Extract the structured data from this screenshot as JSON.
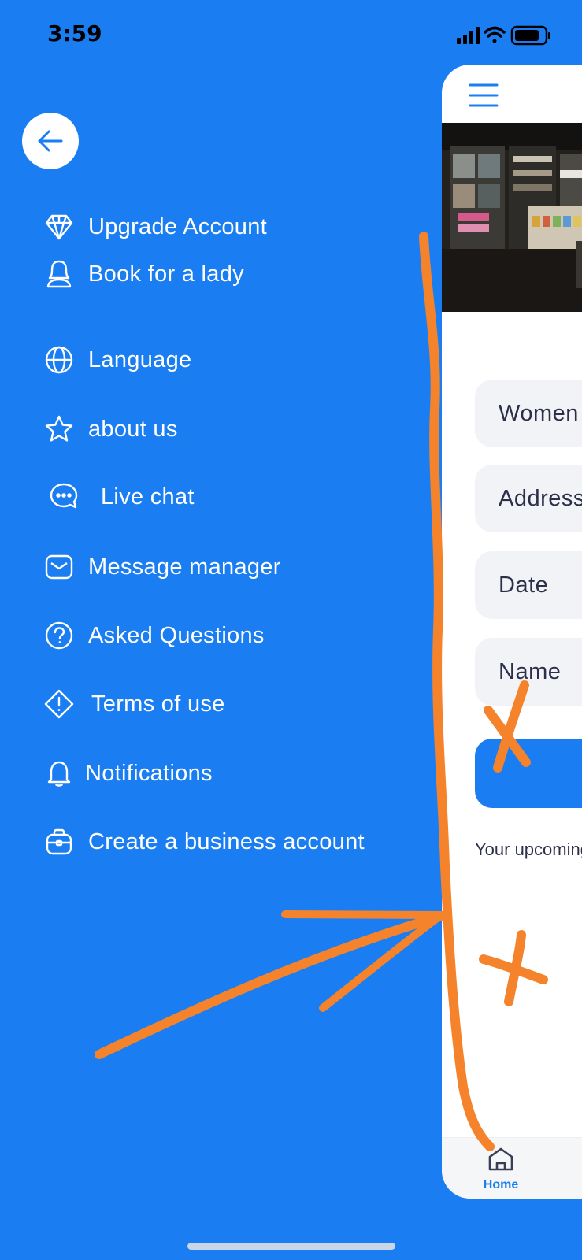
{
  "status_bar": {
    "time": "3:59"
  },
  "menu": {
    "items": [
      {
        "label": "Upgrade Account",
        "icon": "diamond-icon"
      },
      {
        "label": "Book for a lady",
        "icon": "woman-icon"
      },
      {
        "label": "Language",
        "icon": "globe-icon"
      },
      {
        "label": "about us",
        "icon": "star-icon"
      },
      {
        "label": "Live chat",
        "icon": "chat-icon"
      },
      {
        "label": "Message manager",
        "icon": "envelope-icon"
      },
      {
        "label": "Asked Questions",
        "icon": "question-icon"
      },
      {
        "label": "Terms of use",
        "icon": "warning-diamond-icon"
      },
      {
        "label": "Notifications",
        "icon": "bell-icon"
      },
      {
        "label": "Create a business account",
        "icon": "briefcase-icon"
      }
    ]
  },
  "main": {
    "fields": [
      {
        "value": "Women"
      },
      {
        "value": "Address"
      },
      {
        "value": "Date"
      },
      {
        "value": "Name"
      }
    ],
    "upcoming_label": "Your upcoming",
    "tabs": [
      {
        "label": "Home",
        "icon": "home-icon"
      }
    ]
  },
  "colors": {
    "background": "#1a7ef2",
    "card": "#ffffff",
    "field": "#f2f3f6",
    "annotation": "#f5832b",
    "text_dark": "#2d2f4a"
  }
}
